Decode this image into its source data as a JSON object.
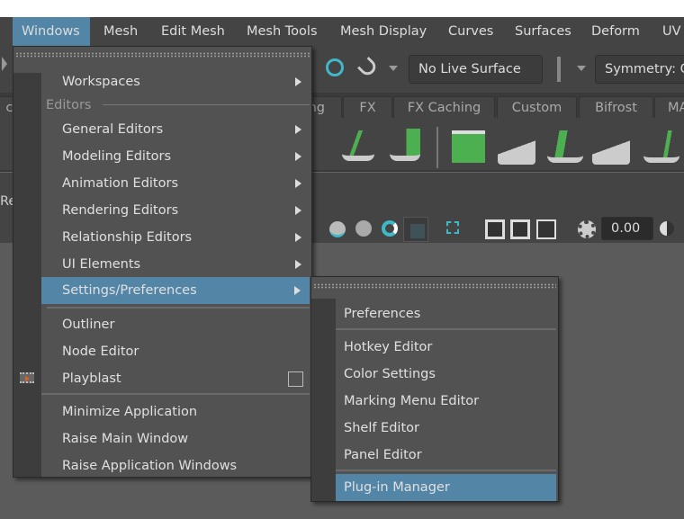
{
  "menubar": {
    "items": [
      "Windows",
      "Mesh",
      "Edit Mesh",
      "Mesh Tools",
      "Mesh Display",
      "Curves",
      "Surfaces",
      "Deform",
      "UV"
    ],
    "active": "Windows"
  },
  "status_line": {
    "live_surface": "No Live Surface",
    "symmetry": "Symmetry: O"
  },
  "shelf_tabs": [
    "cu",
    "ng",
    "FX",
    "FX Caching",
    "Custom",
    "Bifrost",
    "MA"
  ],
  "panel_label": "Re",
  "toolbar": {
    "exposure_value": "0.00"
  },
  "windows_menu": {
    "top": [
      {
        "label": "Workspaces",
        "submenu": true
      }
    ],
    "section_label": "Editors",
    "editors": [
      {
        "label": "General Editors",
        "submenu": true
      },
      {
        "label": "Modeling Editors",
        "submenu": true
      },
      {
        "label": "Animation Editors",
        "submenu": true
      },
      {
        "label": "Rendering Editors",
        "submenu": true
      },
      {
        "label": "Relationship Editors",
        "submenu": true
      },
      {
        "label": "UI Elements",
        "submenu": true
      },
      {
        "label": "Settings/Preferences",
        "submenu": true,
        "highlighted": true
      }
    ],
    "tools": [
      {
        "label": "Outliner"
      },
      {
        "label": "Node Editor"
      },
      {
        "label": "Playblast",
        "option_box": true,
        "icon": "film-icon"
      }
    ],
    "app": [
      {
        "label": "Minimize Application"
      },
      {
        "label": "Raise Main Window"
      },
      {
        "label": "Raise Application Windows"
      }
    ]
  },
  "settings_submenu": {
    "items": [
      "Preferences",
      "Hotkey Editor",
      "Color Settings",
      "Marking Menu Editor",
      "Shelf Editor",
      "Panel Editor",
      "Plug-in Manager"
    ],
    "highlighted": "Plug-in Manager"
  },
  "colors": {
    "highlight": "#5285a6",
    "menu_bg": "#525252",
    "ui_bg": "#444444",
    "accent_green": "#4caf50",
    "accent_teal": "#3fb8c8"
  }
}
